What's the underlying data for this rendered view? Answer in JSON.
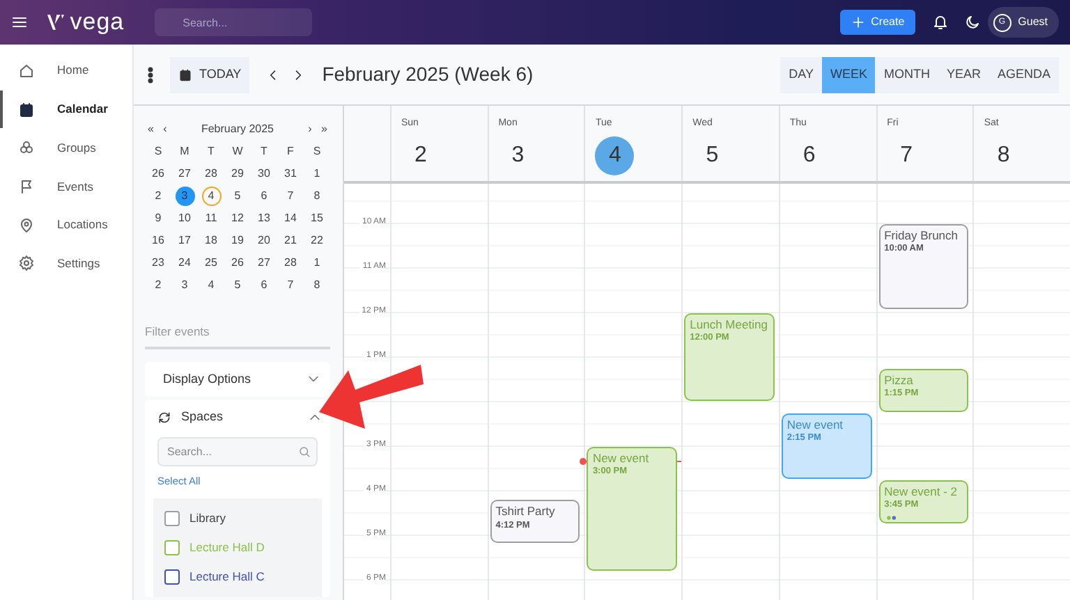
{
  "topbar": {
    "brand": "vega",
    "search": {
      "placeholder": "Search..."
    },
    "create_label": "Create",
    "user": {
      "initial": "G",
      "name": "Guest"
    }
  },
  "sidebar": {
    "items": [
      {
        "label": "Home",
        "selected": false
      },
      {
        "label": "Calendar",
        "selected": true
      },
      {
        "label": "Groups",
        "selected": false
      },
      {
        "label": "Events",
        "selected": false
      },
      {
        "label": "Locations",
        "selected": false
      },
      {
        "label": "Settings",
        "selected": false
      }
    ]
  },
  "toolbar": {
    "today_label": "TODAY",
    "title": "February 2025 (Week 6)",
    "views": [
      {
        "label": "DAY",
        "selected": false
      },
      {
        "label": "WEEK",
        "selected": true
      },
      {
        "label": "MONTH",
        "selected": false
      },
      {
        "label": "YEAR",
        "selected": false
      },
      {
        "label": "AGENDA",
        "selected": false
      }
    ]
  },
  "mini_calendar": {
    "first": "«",
    "prev": "‹",
    "title": "February 2025",
    "next": "›",
    "last": "»",
    "weekdays": [
      "S",
      "M",
      "T",
      "W",
      "T",
      "F",
      "S"
    ],
    "weeks": [
      [
        {
          "label": "26",
          "selected": false,
          "today": false
        },
        {
          "label": "27",
          "selected": false,
          "today": false
        },
        {
          "label": "28",
          "selected": false,
          "today": false
        },
        {
          "label": "29",
          "selected": false,
          "today": false
        },
        {
          "label": "30",
          "selected": false,
          "today": false
        },
        {
          "label": "31",
          "selected": false,
          "today": false
        },
        {
          "label": "1",
          "selected": false,
          "today": false
        }
      ],
      [
        {
          "label": "2",
          "selected": false,
          "today": false
        },
        {
          "label": "3",
          "selected": true,
          "today": false
        },
        {
          "label": "4",
          "selected": false,
          "today": true
        },
        {
          "label": "5",
          "selected": false,
          "today": false
        },
        {
          "label": "6",
          "selected": false,
          "today": false
        },
        {
          "label": "7",
          "selected": false,
          "today": false
        },
        {
          "label": "8",
          "selected": false,
          "today": false
        }
      ],
      [
        {
          "label": "9",
          "selected": false,
          "today": false
        },
        {
          "label": "10",
          "selected": false,
          "today": false
        },
        {
          "label": "11",
          "selected": false,
          "today": false
        },
        {
          "label": "12",
          "selected": false,
          "today": false
        },
        {
          "label": "13",
          "selected": false,
          "today": false
        },
        {
          "label": "14",
          "selected": false,
          "today": false
        },
        {
          "label": "15",
          "selected": false,
          "today": false
        }
      ],
      [
        {
          "label": "16",
          "selected": false,
          "today": false
        },
        {
          "label": "17",
          "selected": false,
          "today": false
        },
        {
          "label": "18",
          "selected": false,
          "today": false
        },
        {
          "label": "19",
          "selected": false,
          "today": false
        },
        {
          "label": "20",
          "selected": false,
          "today": false
        },
        {
          "label": "21",
          "selected": false,
          "today": false
        },
        {
          "label": "22",
          "selected": false,
          "today": false
        }
      ],
      [
        {
          "label": "23",
          "selected": false,
          "today": false
        },
        {
          "label": "24",
          "selected": false,
          "today": false
        },
        {
          "label": "25",
          "selected": false,
          "today": false
        },
        {
          "label": "26",
          "selected": false,
          "today": false
        },
        {
          "label": "27",
          "selected": false,
          "today": false
        },
        {
          "label": "28",
          "selected": false,
          "today": false
        },
        {
          "label": "1",
          "selected": false,
          "today": false
        }
      ],
      [
        {
          "label": "2",
          "selected": false,
          "today": false
        },
        {
          "label": "3",
          "selected": false,
          "today": false
        },
        {
          "label": "4",
          "selected": false,
          "today": false
        },
        {
          "label": "5",
          "selected": false,
          "today": false
        },
        {
          "label": "6",
          "selected": false,
          "today": false
        },
        {
          "label": "7",
          "selected": false,
          "today": false
        },
        {
          "label": "8",
          "selected": false,
          "today": false
        }
      ]
    ]
  },
  "filter": {
    "placeholder": "Filter events"
  },
  "display_options": {
    "label": "Display Options",
    "expanded": false
  },
  "spaces": {
    "label": "Spaces",
    "expanded": true,
    "search": {
      "placeholder": "Search..."
    },
    "select_all": "Select All",
    "items": [
      {
        "label": "Library",
        "checked": false,
        "color": "#9e9e9e"
      },
      {
        "label": "Lecture Hall D",
        "checked": false,
        "color": "#8bc34a"
      },
      {
        "label": "Lecture Hall C",
        "checked": false,
        "color": "#3f51b5"
      }
    ]
  },
  "hours": [
    {
      "label": "10 AM"
    },
    {
      "label": "11 AM"
    },
    {
      "label": "12 PM"
    },
    {
      "label": "1 PM"
    },
    {
      "label": "3 PM"
    },
    {
      "label": "4 PM"
    },
    {
      "label": "5 PM"
    },
    {
      "label": "6 PM"
    }
  ],
  "now_line": true,
  "days": [
    {
      "weekday": "Sun",
      "date": "2",
      "selected": false
    },
    {
      "weekday": "Mon",
      "date": "3",
      "selected": false,
      "events": [
        {
          "title": "Tshirt Party",
          "time": "4:12 PM",
          "color": "#9e9e9e",
          "dots": false
        }
      ]
    },
    {
      "weekday": "Tue",
      "date": "4",
      "selected": true,
      "events": [
        {
          "title": "New event",
          "time": "3:00 PM",
          "color": "#8bc34a",
          "dots": false
        }
      ]
    },
    {
      "weekday": "Wed",
      "date": "5",
      "selected": false,
      "events": [
        {
          "title": "Lunch Meeting",
          "time": "12:00 PM",
          "color": "#8bc34a",
          "dots": false
        }
      ]
    },
    {
      "weekday": "Thu",
      "date": "6",
      "selected": false,
      "events": [
        {
          "title": "New event",
          "time": "2:15 PM",
          "color": "#42a5f5",
          "dots": false
        }
      ]
    },
    {
      "weekday": "Fri",
      "date": "7",
      "selected": false,
      "events": [
        {
          "title": "Friday Brunch",
          "time": "10:00 AM",
          "color": "#9e9e9e",
          "dots": false
        },
        {
          "title": "Pizza",
          "time": "1:15 PM",
          "color": "#8bc34a",
          "dots": false
        },
        {
          "title": "New event - 2",
          "time": "3:45 PM",
          "color": "#8bc34a",
          "dots": true
        }
      ]
    },
    {
      "weekday": "Sat",
      "date": "8",
      "selected": false
    }
  ]
}
